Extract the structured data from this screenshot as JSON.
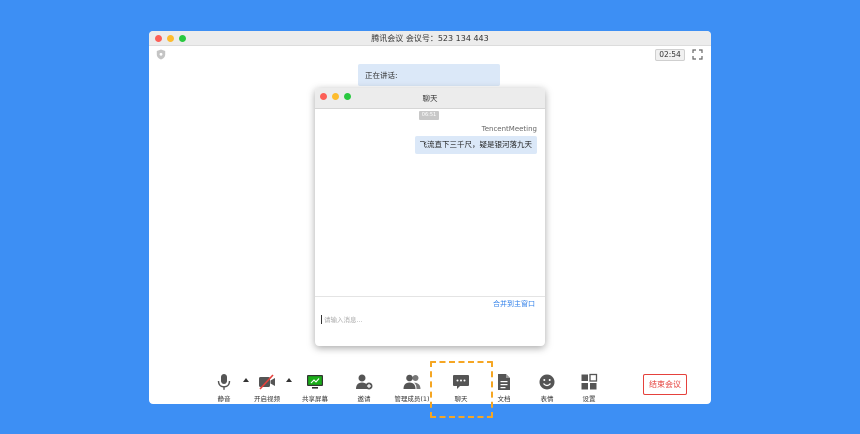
{
  "window": {
    "title": "腾讯会议 会议号：523 134 443"
  },
  "timer": "02:54",
  "speaking": {
    "label": "正在讲话:"
  },
  "chat": {
    "title": "聊天",
    "time": "06:51",
    "sender": "TencentMeeting",
    "message": "飞流直下三千尺，疑是银河落九天",
    "merge_label": "合并到主窗口",
    "input_placeholder": "请输入消息..."
  },
  "toolbar": {
    "mute": "静音",
    "video": "开启视频",
    "share": "共享屏幕",
    "invite": "邀请",
    "members": "管理成员(1)",
    "chat": "聊天",
    "docs": "文档",
    "emoji": "表情",
    "settings": "设置",
    "end": "结束会议"
  },
  "colors": {
    "background": "#3d8ff4",
    "accent": "#2b7de9",
    "danger": "#e5413c",
    "highlight": "#f5a623",
    "share_green": "#1aad19"
  }
}
